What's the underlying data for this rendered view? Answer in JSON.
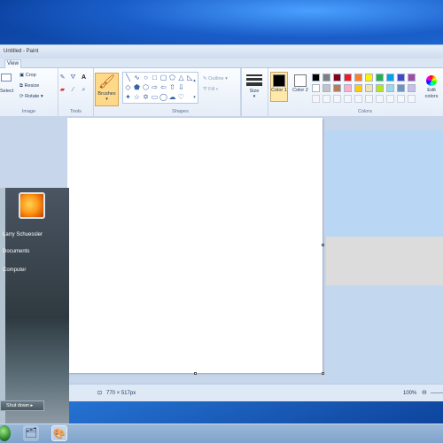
{
  "window": {
    "title": "Untitled - Paint",
    "menu_tab": "View"
  },
  "ribbon": {
    "image": {
      "select": "Select",
      "crop": "Crop",
      "resize": "Resize",
      "rotate": "Rotate",
      "label": "Image"
    },
    "tools": {
      "label": "Tools"
    },
    "brushes": "Brushes",
    "shapes": {
      "outline": "Outline",
      "fill": "Fill",
      "label": "Shapes"
    },
    "size": "Size",
    "colors": {
      "color1": "Color 1",
      "color2": "Color 2",
      "edit": "Edit colors",
      "label": "Colors"
    }
  },
  "palette_row1": [
    "#000000",
    "#7f7f7f",
    "#880015",
    "#ed1c24",
    "#ff7f27",
    "#fff200",
    "#22b14c",
    "#00a2e8",
    "#3f48cc",
    "#a349a4"
  ],
  "palette_row2": [
    "#ffffff",
    "#c3c3c3",
    "#b97a57",
    "#ffaec9",
    "#ffc90e",
    "#efe4b0",
    "#b5e61d",
    "#99d9ea",
    "#7092be",
    "#c8bfe7"
  ],
  "status": {
    "dimensions": "770 × 517px",
    "zoom": "100%"
  },
  "start_menu": {
    "user": "Larry Schuessler",
    "items": [
      "Documents",
      "Computer"
    ],
    "shutdown": "Shut down"
  },
  "taskbar": {
    "icons": [
      "start-orb",
      "windows-explorer-icon",
      "paint-icon"
    ]
  }
}
